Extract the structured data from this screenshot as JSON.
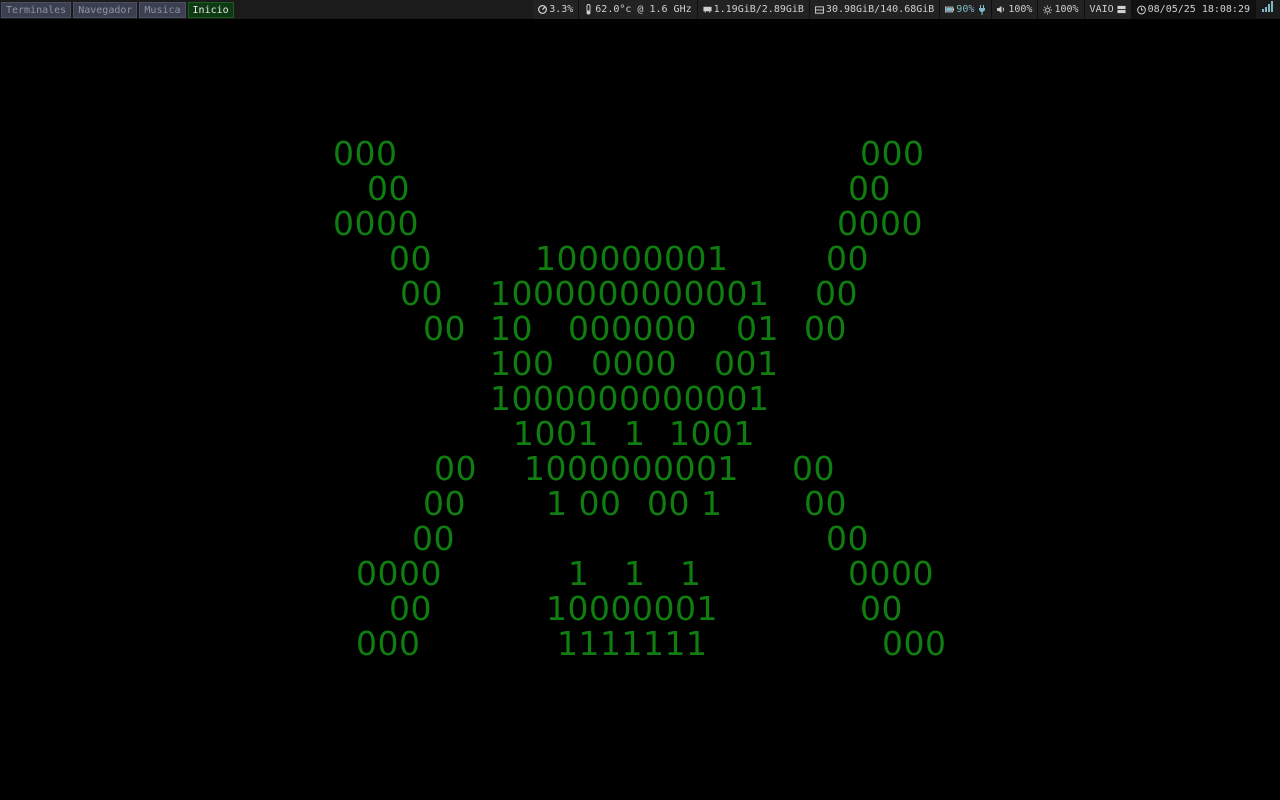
{
  "workspaces": [
    {
      "label": "Terminales",
      "active": false
    },
    {
      "label": "Navegador",
      "active": false
    },
    {
      "label": "Musica",
      "active": false
    },
    {
      "label": "Inicio",
      "active": true
    }
  ],
  "status": {
    "cpu": {
      "icon": "speedometer-icon",
      "value": "3.3%"
    },
    "temp": {
      "icon": "thermometer-icon",
      "value": "62.0°c @ 1.6 GHz"
    },
    "memory": {
      "icon": "memory-icon",
      "value": "1.19GiB/2.89GiB"
    },
    "disk": {
      "icon": "disk-icon",
      "value": "30.98GiB/140.68GiB"
    },
    "battery": {
      "icon": "battery-icon",
      "value": "90%",
      "charging_icon": "plug-icon"
    },
    "volume": {
      "icon": "speaker-icon",
      "value": "100%"
    },
    "brightness": {
      "icon": "sun-icon",
      "value": "100%"
    },
    "host": {
      "label": "VAIO",
      "icon": "server-icon"
    },
    "datetime": {
      "icon": "clock-icon",
      "value": "08/05/25 18:08:29"
    },
    "wifi": {
      "icon": "wifi-signal-icon"
    }
  },
  "art": {
    "color": "#0f7d0f",
    "lines": [
      "000",
      "000",
      "00",
      "00",
      "0000",
      "0000",
      "00",
      "100000001",
      "00",
      "00",
      "1000000000001",
      "00",
      "00",
      "10",
      "000000",
      "01",
      "00",
      "100",
      "0000",
      "001",
      "1000000000001",
      "1001",
      "1",
      "1001",
      "00",
      "1000000001",
      "00",
      "00",
      "1 00",
      "00 1",
      "00",
      "00",
      "00",
      "0000",
      "1",
      "1",
      "1",
      "0000",
      "00",
      "10000001",
      "00",
      "000",
      "1111111",
      "000"
    ]
  },
  "colors": {
    "background": "#000000",
    "topbar": "#1b1b1b",
    "workspace_inactive": "#3b3f4f",
    "workspace_active": "#0d3a12",
    "battery_text": "#7fb9c9"
  }
}
